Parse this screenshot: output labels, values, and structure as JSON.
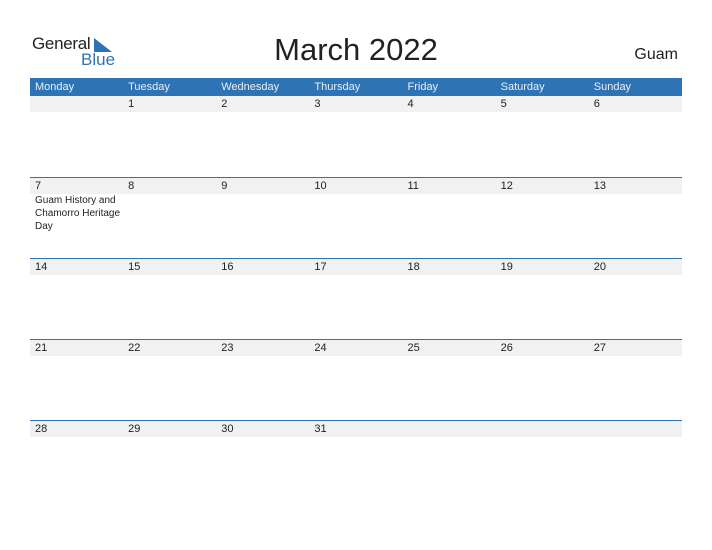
{
  "logo": {
    "general": "General",
    "blue": "Blue"
  },
  "title": "March 2022",
  "region": "Guam",
  "colors": {
    "accent": "#2e74b5",
    "date_row_bg": "#f1f1f1"
  },
  "weekdays": [
    "Monday",
    "Tuesday",
    "Wednesday",
    "Thursday",
    "Friday",
    "Saturday",
    "Sunday"
  ],
  "weeks": [
    {
      "days": [
        "",
        "1",
        "2",
        "3",
        "4",
        "5",
        "6"
      ],
      "events": [
        "",
        "",
        "",
        "",
        "",
        "",
        ""
      ]
    },
    {
      "days": [
        "7",
        "8",
        "9",
        "10",
        "11",
        "12",
        "13"
      ],
      "events": [
        "Guam History and Chamorro Heritage Day",
        "",
        "",
        "",
        "",
        "",
        ""
      ]
    },
    {
      "days": [
        "14",
        "15",
        "16",
        "17",
        "18",
        "19",
        "20"
      ],
      "events": [
        "",
        "",
        "",
        "",
        "",
        "",
        ""
      ]
    },
    {
      "days": [
        "21",
        "22",
        "23",
        "24",
        "25",
        "26",
        "27"
      ],
      "events": [
        "",
        "",
        "",
        "",
        "",
        "",
        ""
      ]
    },
    {
      "days": [
        "28",
        "29",
        "30",
        "31",
        "",
        "",
        ""
      ],
      "events": [
        "",
        "",
        "",
        "",
        "",
        "",
        ""
      ]
    }
  ]
}
